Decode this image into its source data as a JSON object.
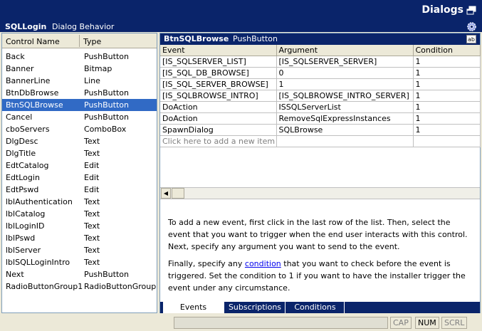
{
  "window": {
    "title": "Dialogs"
  },
  "dialog": {
    "name": "SQLLogin",
    "behavior_label": "Dialog Behavior"
  },
  "controls": {
    "headers": [
      "Control Name",
      "Type"
    ],
    "selected_index": 4,
    "rows": [
      {
        "name": "Back",
        "type": "PushButton"
      },
      {
        "name": "Banner",
        "type": "Bitmap"
      },
      {
        "name": "BannerLine",
        "type": "Line"
      },
      {
        "name": "BtnDbBrowse",
        "type": "PushButton"
      },
      {
        "name": "BtnSQLBrowse",
        "type": "PushButton"
      },
      {
        "name": "Cancel",
        "type": "PushButton"
      },
      {
        "name": "cboServers",
        "type": "ComboBox"
      },
      {
        "name": "DlgDesc",
        "type": "Text"
      },
      {
        "name": "DlgTitle",
        "type": "Text"
      },
      {
        "name": "EdtCatalog",
        "type": "Edit"
      },
      {
        "name": "EdtLogin",
        "type": "Edit"
      },
      {
        "name": "EdtPswd",
        "type": "Edit"
      },
      {
        "name": "lblAuthentication",
        "type": "Text"
      },
      {
        "name": "lblCatalog",
        "type": "Text"
      },
      {
        "name": "lblLoginID",
        "type": "Text"
      },
      {
        "name": "lblPswd",
        "type": "Text"
      },
      {
        "name": "lblServer",
        "type": "Text"
      },
      {
        "name": "lblSQLLoginIntro",
        "type": "Text"
      },
      {
        "name": "Next",
        "type": "PushButton"
      },
      {
        "name": "RadioButtonGroup1",
        "type": "RadioButtonGroup"
      }
    ]
  },
  "selected_control": {
    "name": "BtnSQLBrowse",
    "type": "PushButton",
    "icon": "ab-icon"
  },
  "events": {
    "headers": [
      "Event",
      "Argument",
      "Condition"
    ],
    "rows": [
      [
        "[IS_SQLSERVER_LIST]",
        "[IS_SQLSERVER_SERVER]",
        "1"
      ],
      [
        "[IS_SQL_DB_BROWSE]",
        "0",
        "1"
      ],
      [
        "[IS_SQL_SERVER_BROWSE]",
        "1",
        "1"
      ],
      [
        "[IS_SQLBROWSE_INTRO]",
        "[IS_SQLBROWSE_INTRO_SERVER]",
        "1"
      ],
      [
        "DoAction",
        "ISSQLServerList",
        "1"
      ],
      [
        "DoAction",
        "RemoveSqlExpressInstances",
        "1"
      ],
      [
        "SpawnDialog",
        "SQLBrowse",
        "1"
      ]
    ],
    "add_placeholder": "Click here to add a new item"
  },
  "help": {
    "para1": "To add a new event, first click in the last row of the list. Then, select the event that you want to trigger when the end user interacts with this control. Next, specify any argument you want to send to the event.",
    "para2_before": "Finally, specify any ",
    "para2_link": "condition",
    "para2_after": " that you want to check before the event is triggered. Set the condition to 1 if you want to have the installer trigger the event under any circumstance."
  },
  "tabs": [
    {
      "label": "Events",
      "active": true
    },
    {
      "label": "Subscriptions",
      "active": false
    },
    {
      "label": "Conditions",
      "active": false
    }
  ],
  "status": {
    "cap": "CAP",
    "num": "NUM",
    "scrl": "SCRL"
  },
  "colors": {
    "title_bar": "#0a246a",
    "selection": "#316ac5",
    "link": "#0000ee"
  }
}
